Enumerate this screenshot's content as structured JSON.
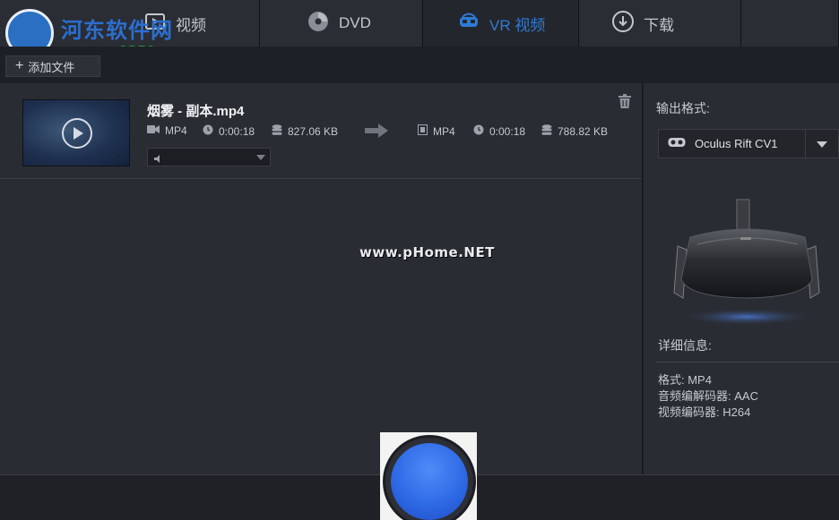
{
  "tabs": [
    {
      "label": "视频",
      "icon": "film-icon"
    },
    {
      "label": "DVD",
      "icon": "disc-icon"
    },
    {
      "label": "VR 视频",
      "icon": "vr-headset-icon",
      "active": true
    },
    {
      "label": "下载",
      "icon": "download-icon"
    }
  ],
  "watermark_logo": {
    "title": "河东软件网",
    "url": "www.pc0359.cn"
  },
  "toolbar": {
    "add_file_label": "添加文件"
  },
  "file": {
    "name": "烟雾 - 副本.mp4",
    "source": {
      "format": "MP4",
      "duration": "0:00:18",
      "size": "827.06 KB"
    },
    "output": {
      "format": "MP4",
      "duration": "0:00:18",
      "size": "788.82 KB"
    }
  },
  "overlay_watermark": "www.pHome.NET",
  "sidebar": {
    "output_format_label": "输出格式:",
    "selected_format": "Oculus Rift CV1",
    "details_label": "详细信息:",
    "details": [
      "格式: MP4",
      "音频编解码器: AAC",
      "视频编码器: H264"
    ]
  },
  "colors": {
    "accent": "#2e7bd6",
    "background": "#2a2c33",
    "convert_button": "#2f6ae6"
  }
}
